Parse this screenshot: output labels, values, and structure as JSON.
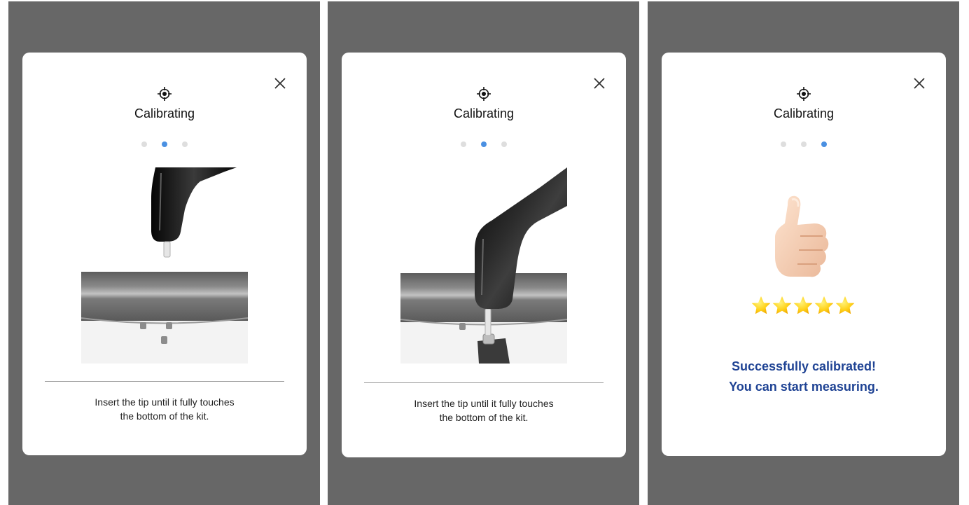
{
  "colors": {
    "backdrop": "#676767",
    "accent": "#4a90e2",
    "success_text": "#1f4394",
    "star": "#ffd21a"
  },
  "icons": {
    "close": "close-icon",
    "header": "crosshair-target-icon",
    "success": "thumbs-up-icon",
    "rating": "star-icon"
  },
  "screens": [
    {
      "title": "Calibrating",
      "step": 2,
      "total_steps": 3,
      "instruction_line1": "Insert the tip until it fully touches",
      "instruction_line2": "the bottom of the kit."
    },
    {
      "title": "Calibrating",
      "step": 2,
      "total_steps": 3,
      "instruction_line1": "Insert the tip until it fully touches",
      "instruction_line2": "the bottom of the kit."
    },
    {
      "title": "Calibrating",
      "step": 3,
      "total_steps": 3,
      "stars": 5,
      "message_line1": "Successfully calibrated!",
      "message_line2": "You can start measuring."
    }
  ]
}
